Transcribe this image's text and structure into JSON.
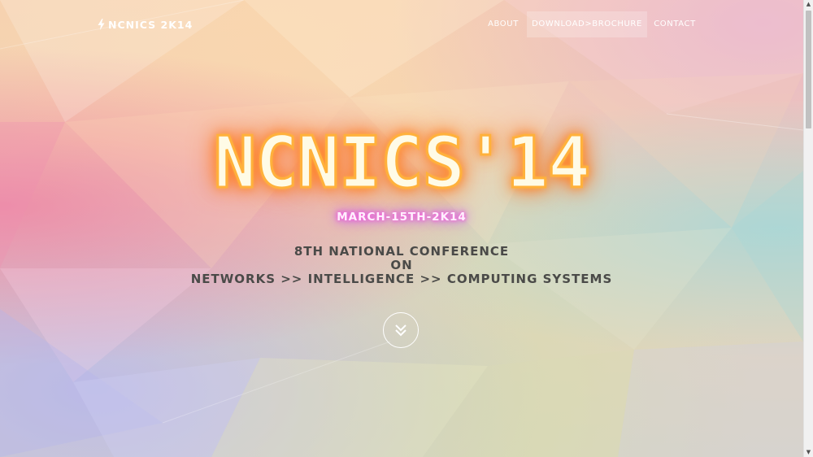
{
  "navbar": {
    "brand_icon": "bolt-icon",
    "brand_text": "NCNICS 2K14",
    "items": [
      {
        "label": "ABOUT"
      },
      {
        "label": "DOWNLOAD>BROCHURE"
      },
      {
        "label": "CONTACT"
      }
    ]
  },
  "hero": {
    "title": "NCNICS'14",
    "date": "MARCH-15TH-2K14",
    "subtitle_lines": [
      "8TH NATIONAL CONFERENCE",
      "ON",
      "NETWORKS >> INTELLIGENCE >> COMPUTING SYSTEMS"
    ],
    "scroll_icon": "double-chevron-down-icon"
  },
  "colors": {
    "title_glow": "#ff7a20",
    "title_fill": "#fffbe6",
    "date_glow": "#e040e0",
    "subtitle_text": "#4a4a48",
    "nav_text": "#ffffff"
  },
  "scrollbar": {
    "up_icon": "scroll-up-arrow-icon",
    "down_icon": "scroll-down-arrow-icon"
  }
}
